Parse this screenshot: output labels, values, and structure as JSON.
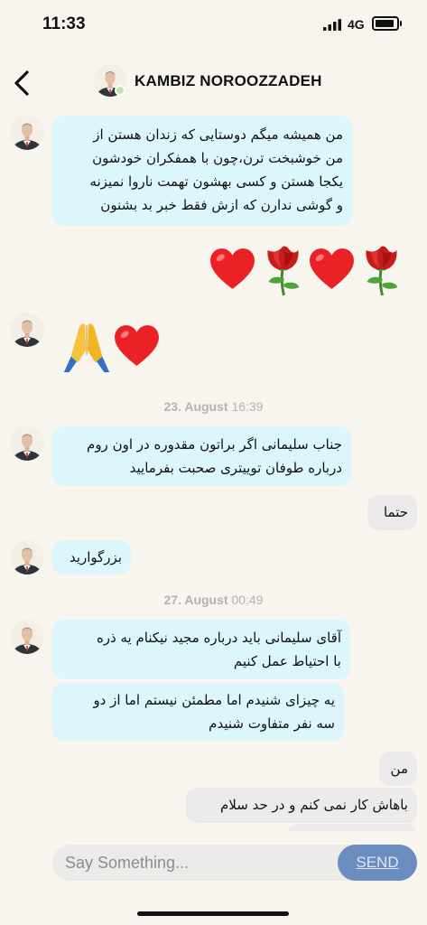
{
  "status": {
    "time": "11:33",
    "network": "4G"
  },
  "header": {
    "contact_name": "KAMBIZ NOROOZZADEH"
  },
  "messages": {
    "m1": [
      "من همیشه میگم دوستایی که زندان هستن از",
      "من خوشبخت ترن،چون با همفکران خودشون",
      "یکجا هستن و کسی بهشون تهمت ناروا نمیزنه",
      "و گوشی ندارن که ازش فقط خبر بد بشنون"
    ],
    "m3": [
      "جناب سلیمانی اگر براتون مقدوره در اون روم",
      "درباره طوفان توییتری صحبت بفرمایید"
    ],
    "m4": "حتما",
    "m5": "بزرگوارید",
    "m6": [
      "آقای سلیمانی باید درباره مجید نیکنام یه ذره",
      "با احتیاط عمل کنیم"
    ],
    "m7": [
      "یه چیزای شنیدم اما مطمئن نیستم اما از دو",
      "سه نفر متفاوت شنیدم"
    ],
    "m8": "من",
    "m9": "باهاش کار نمی کنم و در حد سلام"
  },
  "dates": {
    "d1": {
      "day": "23. August",
      "time": "16:39"
    },
    "d2": {
      "day": "27. August",
      "time": "00:49"
    }
  },
  "composer": {
    "placeholder": "Say Something...",
    "send_label": "SEND"
  },
  "colors": {
    "incoming_bubble": "#dcf6fb",
    "outgoing_bubble": "#eceaea",
    "send_button": "#6b8cbf",
    "background": "#f8f5ee"
  }
}
